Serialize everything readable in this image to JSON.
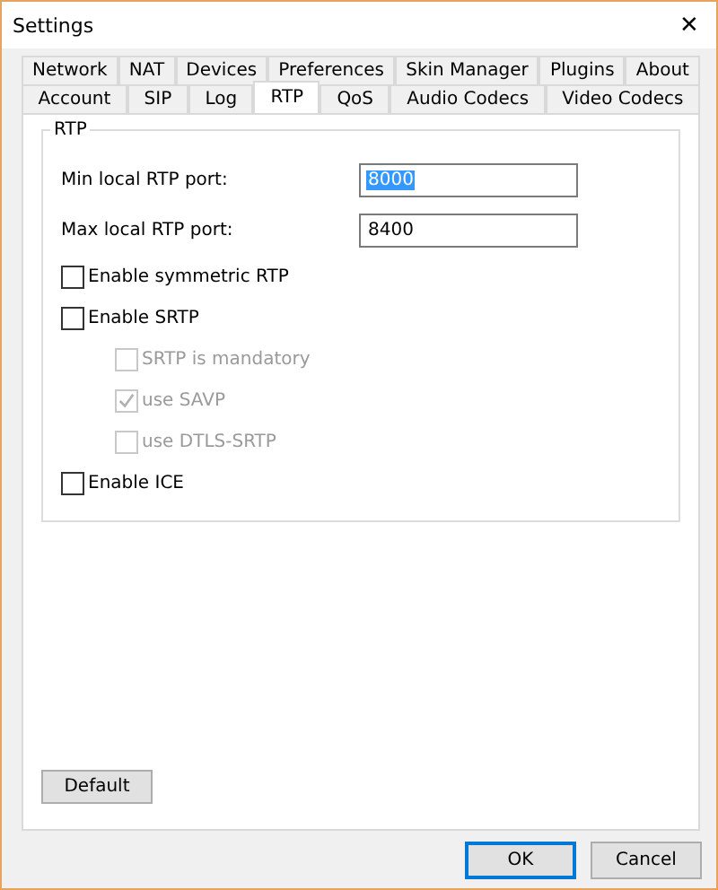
{
  "window": {
    "title": "Settings",
    "close": "✕"
  },
  "tab_rows": [
    {
      "tabs": [
        {
          "label": "Network",
          "selected": false
        },
        {
          "label": "NAT",
          "selected": false
        },
        {
          "label": "Devices",
          "selected": false
        },
        {
          "label": "Preferences",
          "selected": false
        },
        {
          "label": "Skin Manager",
          "selected": false
        },
        {
          "label": "Plugins",
          "selected": false
        },
        {
          "label": "About",
          "selected": false
        }
      ]
    },
    {
      "tabs": [
        {
          "label": "Account",
          "selected": false
        },
        {
          "label": "SIP",
          "selected": false
        },
        {
          "label": "Log",
          "selected": false
        },
        {
          "label": "RTP",
          "selected": true
        },
        {
          "label": "QoS",
          "selected": false
        },
        {
          "label": "Audio Codecs",
          "selected": false
        },
        {
          "label": "Video Codecs",
          "selected": false
        }
      ]
    }
  ],
  "group": {
    "title": "RTP",
    "fields": [
      {
        "label": "Min local RTP port:",
        "value": "8000",
        "text_selected": true
      },
      {
        "label": "Max local RTP port:",
        "value": "8400",
        "text_selected": false
      }
    ],
    "checkboxes": [
      {
        "label": "Enable symmetric RTP",
        "checked": false,
        "disabled": false
      },
      {
        "label": "Enable SRTP",
        "checked": false,
        "disabled": false,
        "children": [
          {
            "label": "SRTP is mandatory",
            "checked": false,
            "disabled": true
          },
          {
            "label": "use SAVP",
            "checked": true,
            "disabled": true
          },
          {
            "label": "use DTLS-SRTP",
            "checked": false,
            "disabled": true
          }
        ]
      },
      {
        "label": "Enable ICE",
        "checked": false,
        "disabled": false
      }
    ]
  },
  "default_button": "Default",
  "buttons": [
    {
      "label": "OK",
      "default": true
    },
    {
      "label": "Cancel",
      "default": false
    }
  ]
}
